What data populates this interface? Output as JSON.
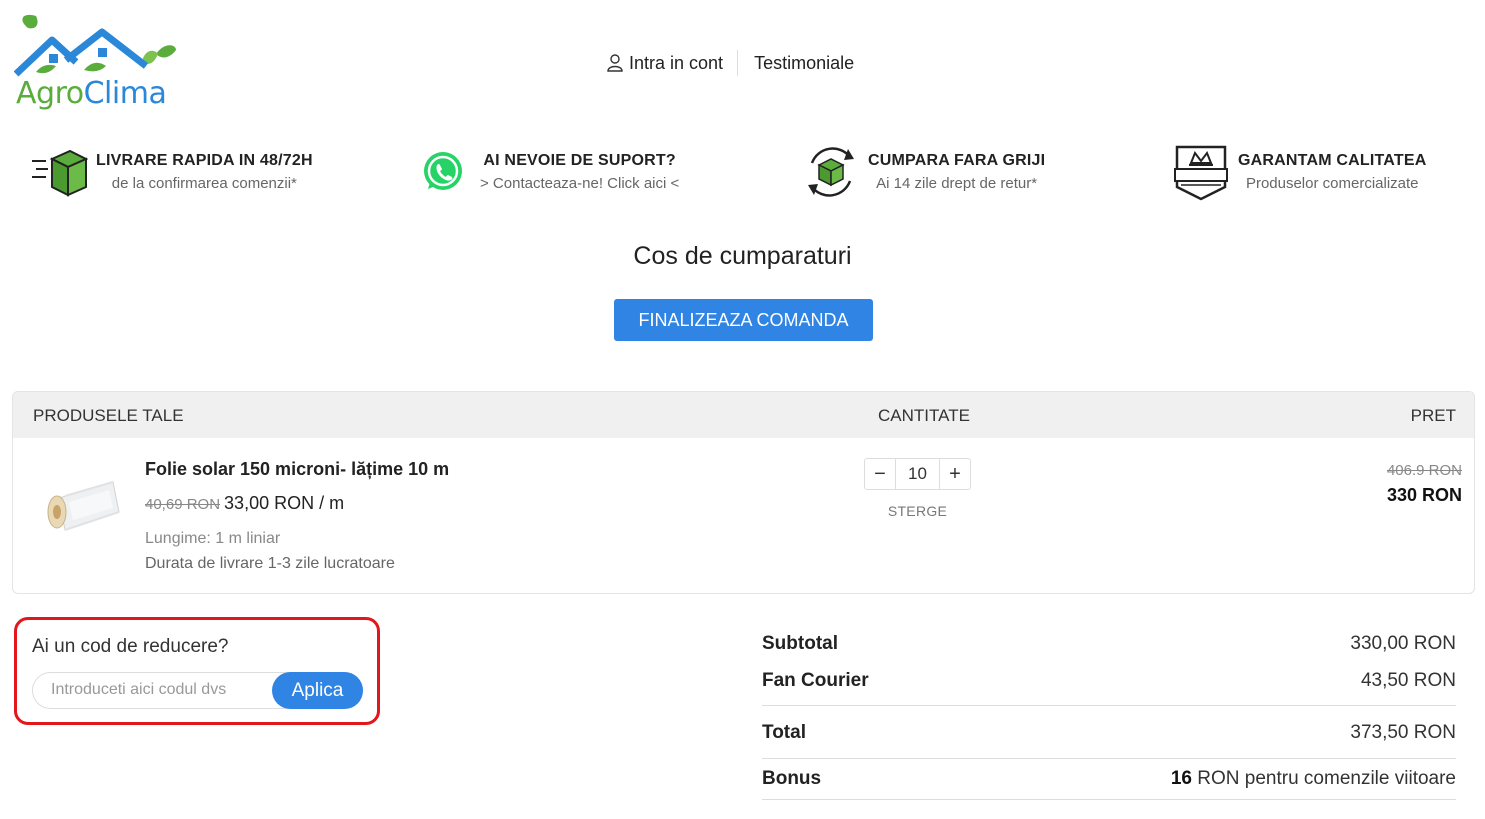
{
  "brand": {
    "name_part1": "Agro",
    "name_part2": "Clima"
  },
  "nav": {
    "login": "Intra in cont",
    "testimonials": "Testimoniale"
  },
  "features": [
    {
      "icon": "delivery-box-icon",
      "title": "LIVRARE RAPIDA IN 48/72H",
      "subtitle": "de la confirmarea comenzii*"
    },
    {
      "icon": "whatsapp-icon",
      "title": "AI NEVOIE DE SUPORT?",
      "subtitle": "> Contacteaza-ne! Click aici <"
    },
    {
      "icon": "return-box-icon",
      "title": "CUMPARA FARA GRIJI",
      "subtitle": "Ai 14 zile drept de retur*"
    },
    {
      "icon": "premium-badge-icon",
      "title": "GARANTAM CALITATEA",
      "subtitle": "Produselor comercializate"
    }
  ],
  "cart": {
    "title": "Cos de cumparaturi",
    "checkout_label": "FINALIZEAZA COMANDA",
    "headers": {
      "products": "PRODUSELE TALE",
      "quantity": "CANTITATE",
      "price": "PRET"
    },
    "items": [
      {
        "name": "Folie solar 150 microni- lățime 10 m",
        "old_unit_price": "40,69 RON",
        "unit_price": "33,00 RON / m",
        "length": "Lungime: 1 m liniar",
        "delivery": "Durata de livrare 1-3 zile lucratoare",
        "quantity": "10",
        "decrement": "−",
        "increment": "+",
        "remove_label": "STERGE",
        "old_total": "406.9 RON",
        "total": "330 RON"
      }
    ]
  },
  "discount": {
    "label": "Ai un cod de reducere?",
    "placeholder": "Introduceti aici codul dvs",
    "apply_label": "Aplica"
  },
  "summary": {
    "subtotal_label": "Subtotal",
    "subtotal_value": "330,00 RON",
    "shipping_label": "Fan Courier",
    "shipping_value": "43,50 RON",
    "total_label": "Total",
    "total_value": "373,50 RON",
    "bonus_label": "Bonus",
    "bonus_amount": "16",
    "bonus_text": " RON pentru comenzile viitoare"
  },
  "colors": {
    "primary": "#2f84e4",
    "brand_green": "#5aac3c",
    "highlight_red": "#e3161c"
  }
}
